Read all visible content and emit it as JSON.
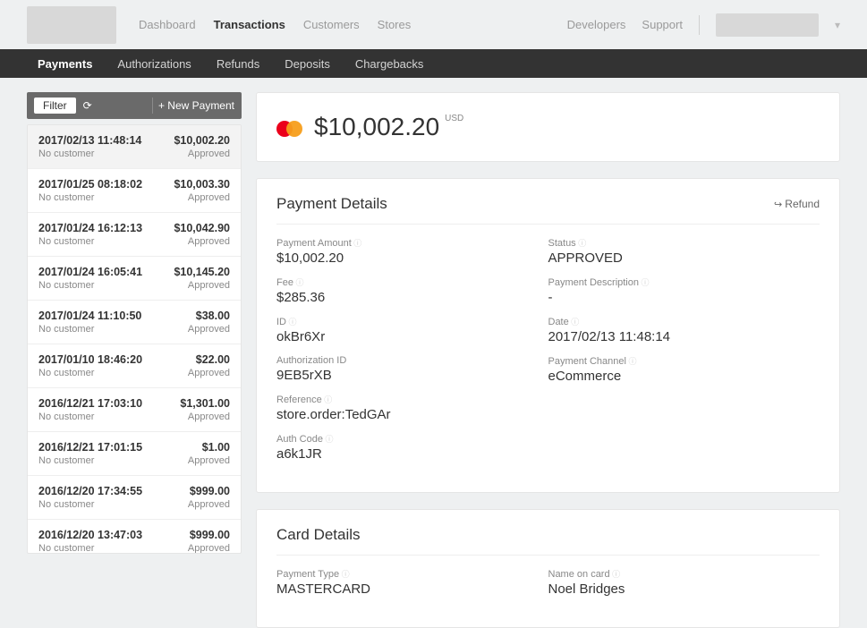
{
  "topnav": {
    "items": [
      "Dashboard",
      "Transactions",
      "Customers",
      "Stores"
    ],
    "active": "Transactions",
    "right": {
      "developers": "Developers",
      "support": "Support"
    }
  },
  "subnav": {
    "items": [
      "Payments",
      "Authorizations",
      "Refunds",
      "Deposits",
      "Chargebacks"
    ],
    "active": "Payments"
  },
  "listToolbar": {
    "filter": "Filter",
    "newPayment": "New Payment"
  },
  "transactions": [
    {
      "date": "2017/02/13 11:48:14",
      "amount": "$10,002.20",
      "customer": "No customer",
      "status": "Approved",
      "selected": true
    },
    {
      "date": "2017/01/25 08:18:02",
      "amount": "$10,003.30",
      "customer": "No customer",
      "status": "Approved"
    },
    {
      "date": "2017/01/24 16:12:13",
      "amount": "$10,042.90",
      "customer": "No customer",
      "status": "Approved"
    },
    {
      "date": "2017/01/24 16:05:41",
      "amount": "$10,145.20",
      "customer": "No customer",
      "status": "Approved"
    },
    {
      "date": "2017/01/24 11:10:50",
      "amount": "$38.00",
      "customer": "No customer",
      "status": "Approved"
    },
    {
      "date": "2017/01/10 18:46:20",
      "amount": "$22.00",
      "customer": "No customer",
      "status": "Approved"
    },
    {
      "date": "2016/12/21 17:03:10",
      "amount": "$1,301.00",
      "customer": "No customer",
      "status": "Approved"
    },
    {
      "date": "2016/12/21 17:01:15",
      "amount": "$1.00",
      "customer": "No customer",
      "status": "Approved"
    },
    {
      "date": "2016/12/20 17:34:55",
      "amount": "$999.00",
      "customer": "No customer",
      "status": "Approved"
    },
    {
      "date": "2016/12/20 13:47:03",
      "amount": "$999.00",
      "customer": "No customer",
      "status": "Approved"
    }
  ],
  "summary": {
    "cardBrand": "mastercard",
    "amount": "$10,002.20",
    "currency": "USD"
  },
  "paymentDetails": {
    "title": "Payment Details",
    "refund": "Refund",
    "left": [
      {
        "label": "Payment Amount",
        "value": "$10,002.20"
      },
      {
        "label": "Fee",
        "value": "$285.36"
      },
      {
        "label": "ID",
        "value": "okBr6Xr"
      },
      {
        "label": "Authorization ID",
        "value": "9EB5rXB",
        "noinfo": true
      },
      {
        "label": "Reference",
        "value": "store.order:TedGAr"
      },
      {
        "label": "Auth Code",
        "value": "a6k1JR"
      }
    ],
    "right": [
      {
        "label": "Status",
        "value": "APPROVED"
      },
      {
        "label": "Payment Description",
        "value": "-"
      },
      {
        "label": "Date",
        "value": "2017/02/13 11:48:14"
      },
      {
        "label": "Payment Channel",
        "value": "eCommerce"
      }
    ]
  },
  "cardDetails": {
    "title": "Card Details",
    "left": [
      {
        "label": "Payment Type",
        "value": "MASTERCARD"
      }
    ],
    "right": [
      {
        "label": "Name on card",
        "value": "Noel Bridges"
      }
    ]
  }
}
